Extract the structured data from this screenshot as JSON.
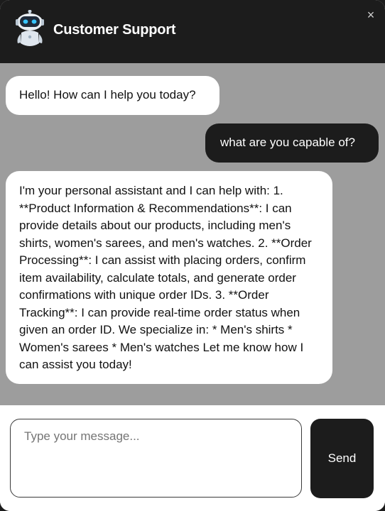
{
  "header": {
    "title": "Customer Support",
    "avatar_icon": "robot-icon",
    "close_label": "×"
  },
  "messages": [
    {
      "sender": "bot",
      "text": "Hello! How can I help you today?"
    },
    {
      "sender": "user",
      "text": "what are you capable of?"
    },
    {
      "sender": "bot",
      "text": "I'm your personal assistant and I can help with: 1. **Product Information & Recommendations**: I can provide details about our products, including men's shirts, women's sarees, and men's watches. 2. **Order Processing**: I can assist with placing orders, confirm item availability, calculate totals, and generate order confirmations with unique order IDs. 3. **Order Tracking**: I can provide real-time order status when given an order ID. We specialize in: * Men's shirts * Women's sarees * Men's watches Let me know how I can assist you today!"
    }
  ],
  "composer": {
    "placeholder": "Type your message...",
    "value": "",
    "send_label": "Send"
  },
  "colors": {
    "header_bg": "#1c1c1c",
    "chat_bg": "#9d9d9d",
    "bot_bubble": "#ffffff",
    "user_bubble": "#1c1c1c"
  }
}
